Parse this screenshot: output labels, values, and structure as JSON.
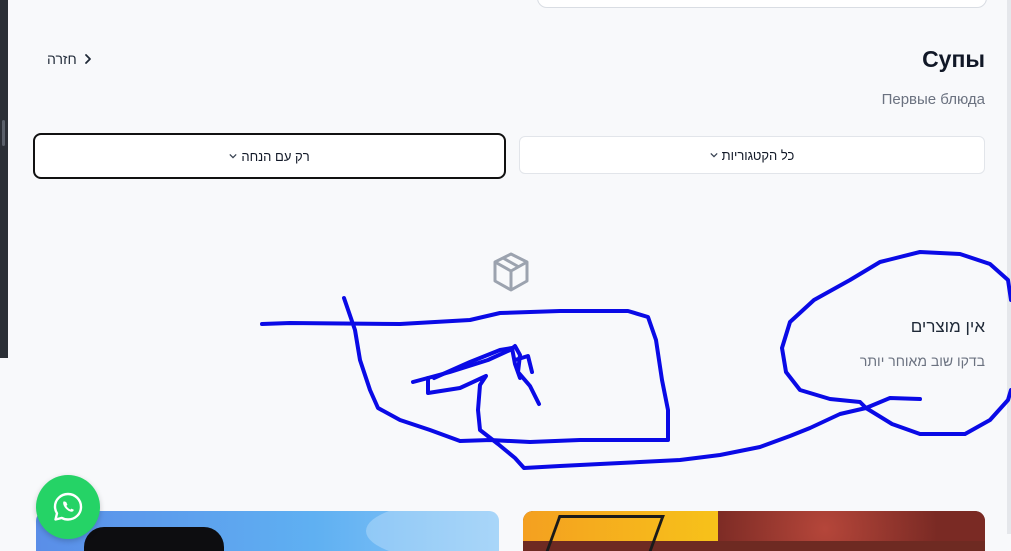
{
  "header": {
    "back_label": "חזרה",
    "title": "Супы",
    "subtitle": "Первые блюда"
  },
  "filters": {
    "discount_label": "רק עם הנחה",
    "category_label": "כל הקטגוריות"
  },
  "empty_state": {
    "icon": "package-icon",
    "title": "אין מוצרים",
    "subtitle": "בדקו שוב מאוחר יותר"
  },
  "colors": {
    "accent_whatsapp": "#25d366",
    "scribble": "#0000ee"
  }
}
